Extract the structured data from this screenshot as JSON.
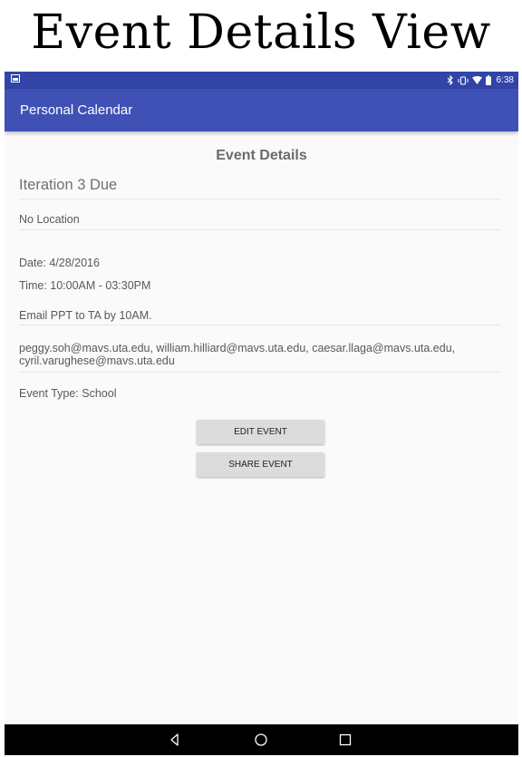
{
  "caption": "Event Details View",
  "status_bar": {
    "time": "6:38",
    "icons": [
      "image-icon",
      "bluetooth-icon",
      "vibrate-icon",
      "wifi-icon",
      "battery-icon"
    ]
  },
  "app_bar": {
    "title": "Personal Calendar"
  },
  "event": {
    "heading": "Event Details",
    "title": "Iteration 3 Due",
    "location": "No Location",
    "date": "Date: 4/28/2016",
    "time": "Time: 10:00AM - 03:30PM",
    "description": "Email PPT to TA by 10AM.",
    "attendees": "peggy.soh@mavs.uta.edu, william.hilliard@mavs.uta.edu, caesar.llaga@mavs.uta.edu, cyril.varughese@mavs.uta.edu",
    "type": "Event Type: School"
  },
  "buttons": {
    "edit": "EDIT EVENT",
    "share": "SHARE EVENT"
  },
  "nav_bar": {
    "icons": [
      "back-icon",
      "home-icon",
      "recents-icon"
    ]
  },
  "colors": {
    "app_bar": "#3f51b5",
    "status_bar": "#3244a8",
    "background": "#fafafa"
  }
}
